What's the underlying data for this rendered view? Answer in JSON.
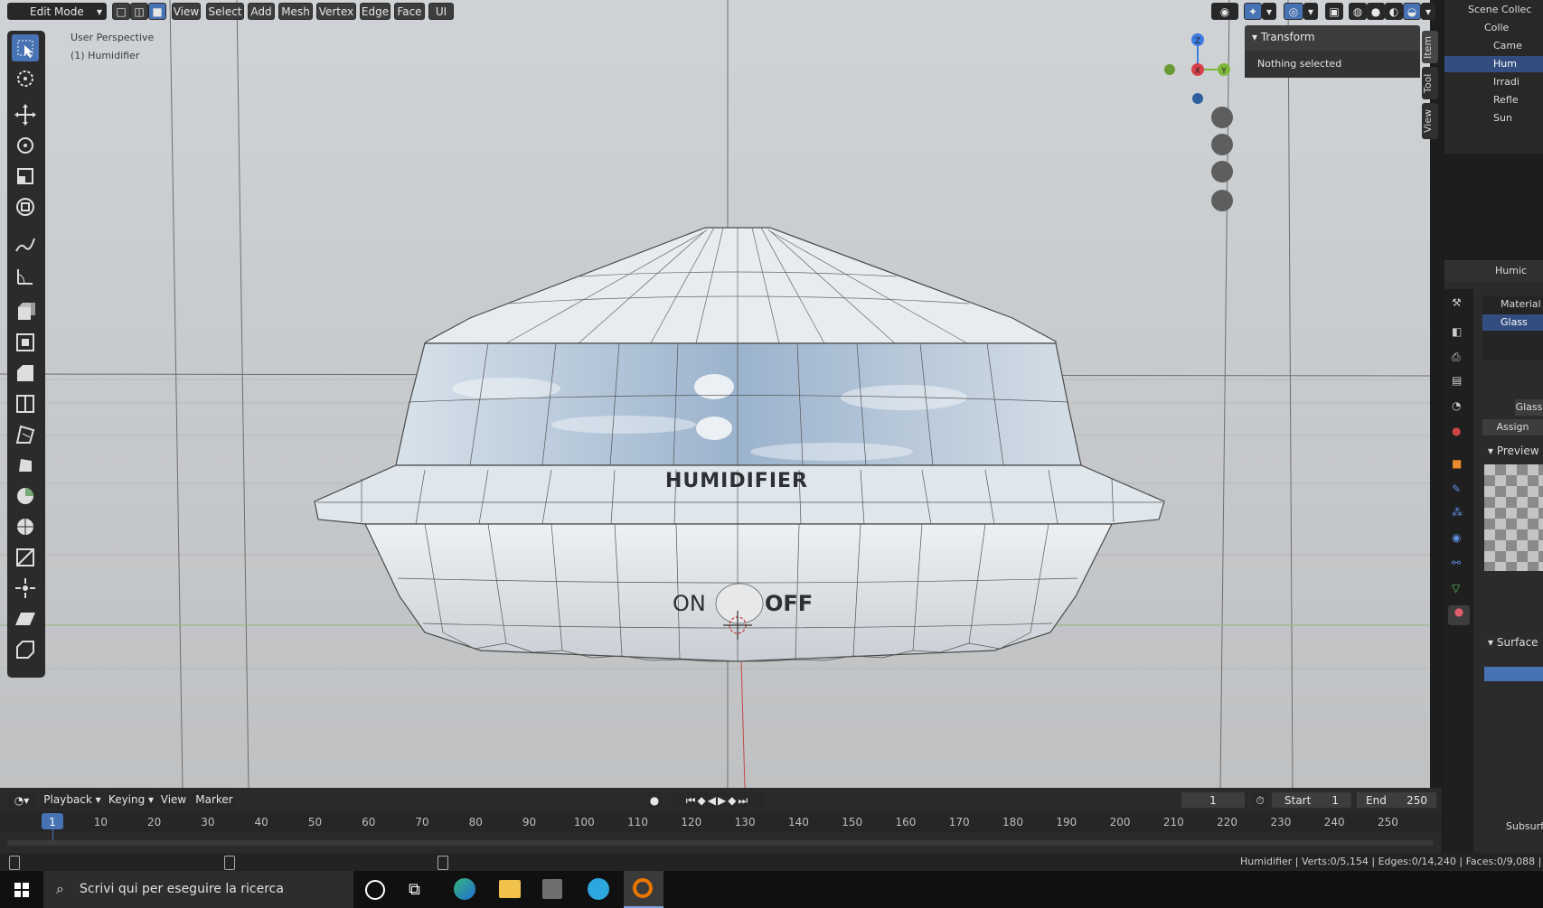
{
  "header": {
    "mode": "Edit Mode",
    "menus": [
      "View",
      "Select",
      "Add",
      "Mesh",
      "Vertex",
      "Edge",
      "Face",
      "UI"
    ]
  },
  "viewport": {
    "perspective": "User Perspective",
    "object_label": "(1) Humidifier",
    "model_text": "HUMIDIFIER",
    "on_label": "ON",
    "off_label": "OFF"
  },
  "gizmo": {
    "z": "Z",
    "x": "X",
    "y": "Y"
  },
  "npanel": {
    "title": "Transform",
    "message": "Nothing selected",
    "tabs": [
      "Item",
      "Tool",
      "View"
    ]
  },
  "outliner": {
    "items": [
      "Scene Collec",
      "Colle",
      "Came",
      "Hum",
      "Irradi",
      "Refle",
      "Sun"
    ]
  },
  "properties": {
    "object_name": "Humic",
    "materials": [
      "Material",
      "Glass"
    ],
    "material_selector": "Glass",
    "assign": "Assign",
    "preview": "Preview",
    "surface": "Surface",
    "subsurf": "Subsurf"
  },
  "timeline": {
    "menus": [
      "Playback",
      "Keying",
      "View",
      "Marker"
    ],
    "current_frame": "1",
    "start_label": "Start",
    "start": "1",
    "end_label": "End",
    "end": "250",
    "ticks": [
      "1",
      "10",
      "20",
      "30",
      "40",
      "50",
      "60",
      "70",
      "80",
      "90",
      "100",
      "110",
      "120",
      "130",
      "140",
      "150",
      "160",
      "170",
      "180",
      "190",
      "200",
      "210",
      "220",
      "230",
      "240",
      "250"
    ]
  },
  "status": {
    "stats": "Humidifier | Verts:0/5,154 | Edges:0/14,240 | Faces:0/9,088 | Tris:1"
  },
  "taskbar": {
    "search_placeholder": "Scrivi qui per eseguire la ricerca"
  }
}
